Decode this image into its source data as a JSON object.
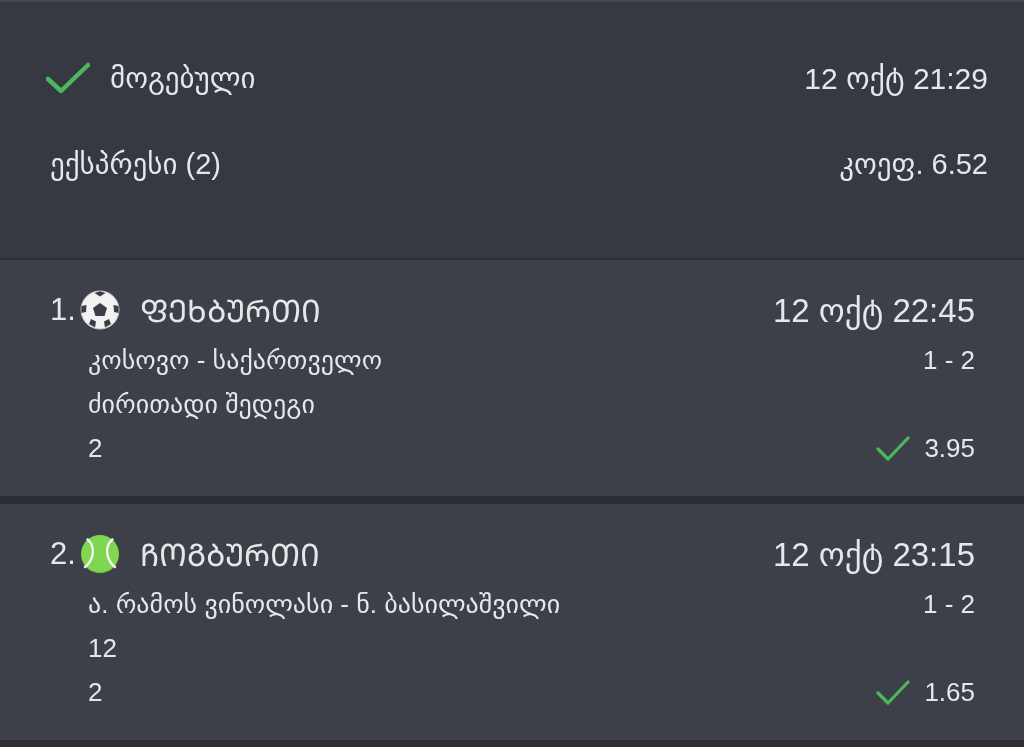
{
  "bet_summary": {
    "status": {
      "label": "მოგებული",
      "won": true
    },
    "placed_at": "12 ოქტ 21:29",
    "bet_type": "ექსპრესი (2)",
    "total_odds": "კოეფ. 6.52"
  },
  "selections": [
    {
      "number": "1.",
      "kind": "football",
      "sport": "ᲤᲔᲮᲑᲣᲠᲗᲘ",
      "start_time": "12 ოქტ 22:45",
      "event": "კოსოვო - საქართველო",
      "score": "1 - 2",
      "market": "ძირითადი შედეგი",
      "pick": "2",
      "won": true,
      "odds": "3.95"
    },
    {
      "number": "2.",
      "kind": "tennis",
      "sport": "ᲩᲝᲒᲑᲣᲠᲗᲘ",
      "start_time": "12 ოქტ 23:15",
      "event": "ა. რამოს ვინოლასი - ნ. ბასილაშვილი",
      "score": "1 - 2",
      "market": "12",
      "pick": "2",
      "won": true,
      "odds": "1.65"
    }
  ]
}
